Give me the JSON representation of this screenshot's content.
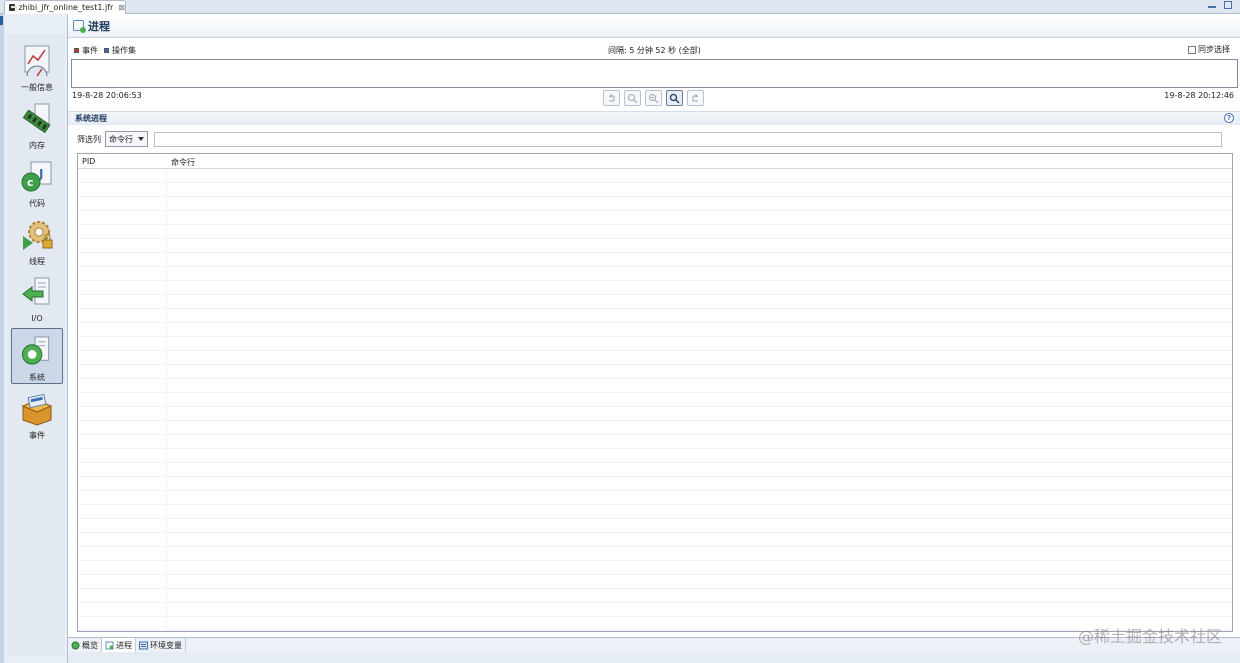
{
  "editor_tab": {
    "title": "zhibi_jfr_online_test1.jfr",
    "close_glyph": "⊠"
  },
  "page": {
    "title": "进程"
  },
  "categories": [
    {
      "label": "一般信息",
      "icon": "gauge-chart-icon"
    },
    {
      "label": "内存",
      "icon": "memory-chip-icon"
    },
    {
      "label": "代码",
      "icon": "code-icon"
    },
    {
      "label": "线程",
      "icon": "threads-gear-icon"
    },
    {
      "label": "I/O",
      "icon": "io-arrow-icon"
    },
    {
      "label": "系统",
      "icon": "system-icon",
      "selected": true
    },
    {
      "label": "事件",
      "icon": "events-box-icon"
    }
  ],
  "timeline": {
    "legend_events": "事件",
    "legend_opset": "操作集",
    "interval": "间隔: 5 分钟 52 秒 (全部)",
    "sync_label": "同步选择",
    "start_time": "19-8-28 20:06:53",
    "end_time": "19-8-28 20:12:46",
    "colors": {
      "events": "#c0392b",
      "opset": "#3a6fb5"
    }
  },
  "section": {
    "title": "系统进程",
    "filter_label": "筛选列",
    "filter_column": "命令行",
    "filter_text": ""
  },
  "table": {
    "columns": [
      "PID",
      "命令行"
    ],
    "rows": []
  },
  "bottom_tabs": [
    {
      "label": "概览",
      "icon": "overview-icon"
    },
    {
      "label": "进程",
      "icon": "process-icon",
      "active": true
    },
    {
      "label": "环境变量",
      "icon": "env-vars-icon"
    }
  ],
  "watermark": "@稀土掘金技术社区"
}
